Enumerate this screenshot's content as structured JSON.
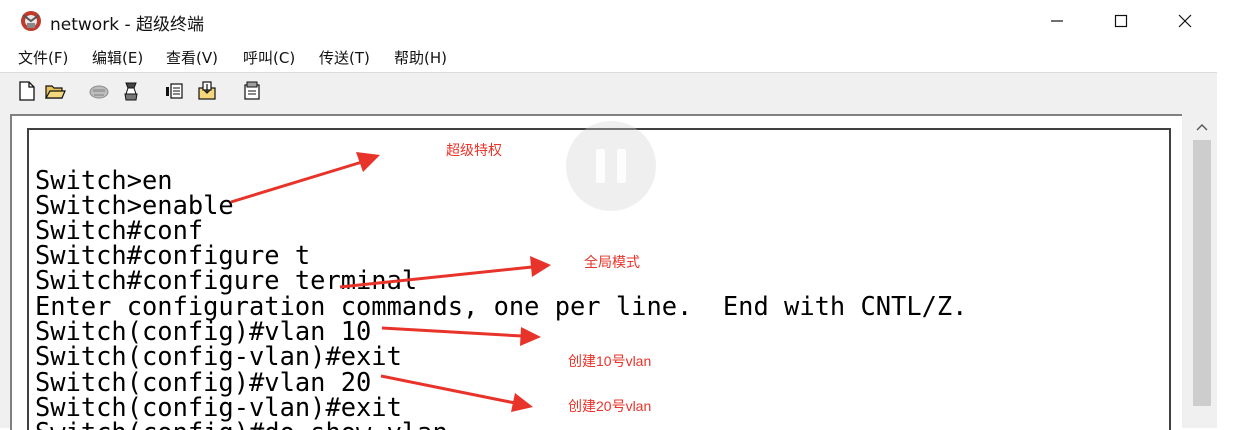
{
  "window": {
    "title": "network - 超级终端",
    "controls": {
      "minimize": "—",
      "maximize": "☐",
      "close": "✕"
    }
  },
  "menu": {
    "items": [
      "文件(F)",
      "编辑(E)",
      "查看(V)",
      "呼叫(C)",
      "传送(T)",
      "帮助(H)"
    ]
  },
  "toolbar": {
    "icons": [
      "new-document-icon",
      "open-folder-icon",
      "disconnect-phone-icon",
      "connect-phone-icon",
      "send-file-icon",
      "receive-file-icon",
      "properties-icon"
    ]
  },
  "terminal": {
    "lines": [
      "Switch>en",
      "Switch>enable",
      "Switch#conf",
      "Switch#configure t",
      "Switch#configure terminal",
      "Enter configuration commands, one per line.  End with CNTL/Z.",
      "Switch(config)#vlan 10",
      "Switch(config-vlan)#exit",
      "Switch(config)#vlan 20",
      "Switch(config-vlan)#exit",
      "Switch(config)#do show vlan"
    ]
  },
  "annotations": {
    "privileged": "超级特权",
    "global_mode": "全局模式",
    "create_vlan10": "创建10号vlan",
    "create_vlan20": "创建20号vlan",
    "color": "#e8332a"
  },
  "video": {
    "icon": "pause-icon"
  }
}
